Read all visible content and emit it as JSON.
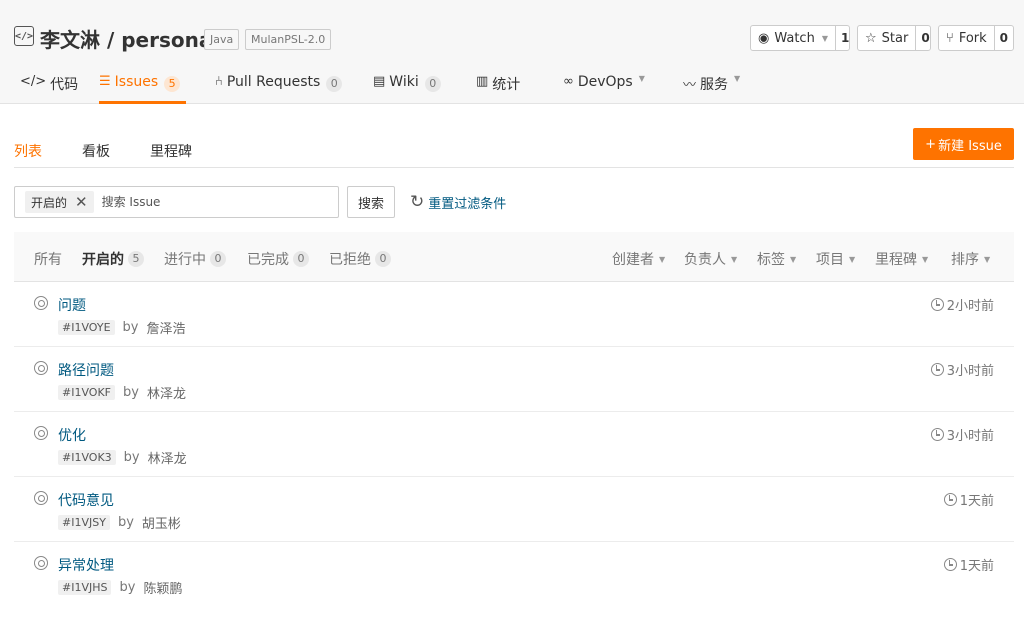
{
  "repo": {
    "owner": "李文淋",
    "name": "personal",
    "title": "李文淋 / personal",
    "icon": "code-repo-icon",
    "language": "Java",
    "license": "MulanPSL-2.0"
  },
  "actions": {
    "watch": {
      "label": "Watch",
      "count": "1",
      "icon": "eye-icon"
    },
    "star": {
      "label": "Star",
      "count": "0",
      "icon": "star-icon"
    },
    "fork": {
      "label": "Fork",
      "count": "0",
      "icon": "fork-icon"
    }
  },
  "tabs": [
    {
      "label": "代码",
      "icon": "code-icon"
    },
    {
      "label": "Issues",
      "count": "5",
      "icon": "issues-icon",
      "active": true
    },
    {
      "label": "Pull Requests",
      "count": "0",
      "icon": "pull-request-icon"
    },
    {
      "label": "Wiki",
      "count": "0",
      "icon": "wiki-icon"
    },
    {
      "label": "统计",
      "icon": "stats-icon"
    },
    {
      "label": "DevOps",
      "icon": "devops-icon",
      "dropdown": true
    },
    {
      "label": "服务",
      "icon": "service-icon",
      "dropdown": true
    }
  ],
  "subnav": {
    "items": [
      "列表",
      "看板",
      "里程碑"
    ],
    "active": "列表",
    "new_issue_label": "新建 Issue"
  },
  "search": {
    "chip_label": "开启的",
    "placeholder": "搜索 Issue",
    "button_label": "搜索",
    "reset_label": "重置过滤条件"
  },
  "states": [
    {
      "label": "所有"
    },
    {
      "label": "开启的",
      "count": "5",
      "active": true
    },
    {
      "label": "进行中",
      "count": "0"
    },
    {
      "label": "已完成",
      "count": "0"
    },
    {
      "label": "已拒绝",
      "count": "0"
    }
  ],
  "filters": [
    "创建者",
    "负责人",
    "标签",
    "项目",
    "里程碑",
    "排序"
  ],
  "issues": [
    {
      "title": "问题",
      "id": "#I1VOYE",
      "by": "by",
      "author": "詹泽浩",
      "time": "2小时前"
    },
    {
      "title": "路径问题",
      "id": "#I1VOKF",
      "by": "by",
      "author": "林泽龙",
      "time": "3小时前"
    },
    {
      "title": "优化",
      "id": "#I1VOK3",
      "by": "by",
      "author": "林泽龙",
      "time": "3小时前"
    },
    {
      "title": "代码意见",
      "id": "#I1VJSY",
      "by": "by",
      "author": "胡玉彬",
      "time": "1天前"
    },
    {
      "title": "异常处理",
      "id": "#I1VJHS",
      "by": "by",
      "author": "陈颖鹏",
      "time": "1天前"
    }
  ],
  "colors": {
    "accent": "#fe7300",
    "link": "#005980",
    "header_bg": "#f7f7f7"
  }
}
